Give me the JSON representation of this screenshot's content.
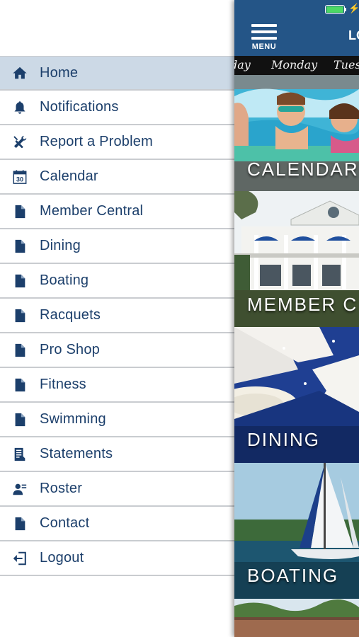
{
  "menu": {
    "items": [
      {
        "label": "Home",
        "icon": "home-icon",
        "active": true
      },
      {
        "label": "Notifications",
        "icon": "bell-icon"
      },
      {
        "label": "Report a Problem",
        "icon": "tools-icon"
      },
      {
        "label": "Calendar",
        "icon": "calendar-icon"
      },
      {
        "label": "Member Central",
        "icon": "document-icon"
      },
      {
        "label": "Dining",
        "icon": "document-icon"
      },
      {
        "label": "Boating",
        "icon": "document-icon"
      },
      {
        "label": "Racquets",
        "icon": "document-icon"
      },
      {
        "label": "Pro Shop",
        "icon": "document-icon"
      },
      {
        "label": "Fitness",
        "icon": "document-icon"
      },
      {
        "label": "Swimming",
        "icon": "document-icon"
      },
      {
        "label": "Statements",
        "icon": "statement-icon"
      },
      {
        "label": "Roster",
        "icon": "roster-icon"
      },
      {
        "label": "Contact",
        "icon": "document-icon"
      },
      {
        "label": "Logout",
        "icon": "logout-icon"
      }
    ],
    "calendar_icon_text": "30"
  },
  "header": {
    "menu_button_label": "MENU",
    "title": "LO",
    "battery_icon": "battery-charging-icon"
  },
  "day_strip": {
    "days": [
      "day",
      "Monday",
      "Tuesd"
    ]
  },
  "tiles": [
    {
      "label": "CALENDAR"
    },
    {
      "label": "MEMBER C"
    },
    {
      "label": "DINING"
    },
    {
      "label": "BOATING"
    }
  ],
  "colors": {
    "brand_blue": "#245587",
    "menu_text": "#1c3f6b",
    "active_row": "#ccd9e6",
    "icon_blue": "#1c3f6b",
    "battery_green": "#4cd964"
  }
}
